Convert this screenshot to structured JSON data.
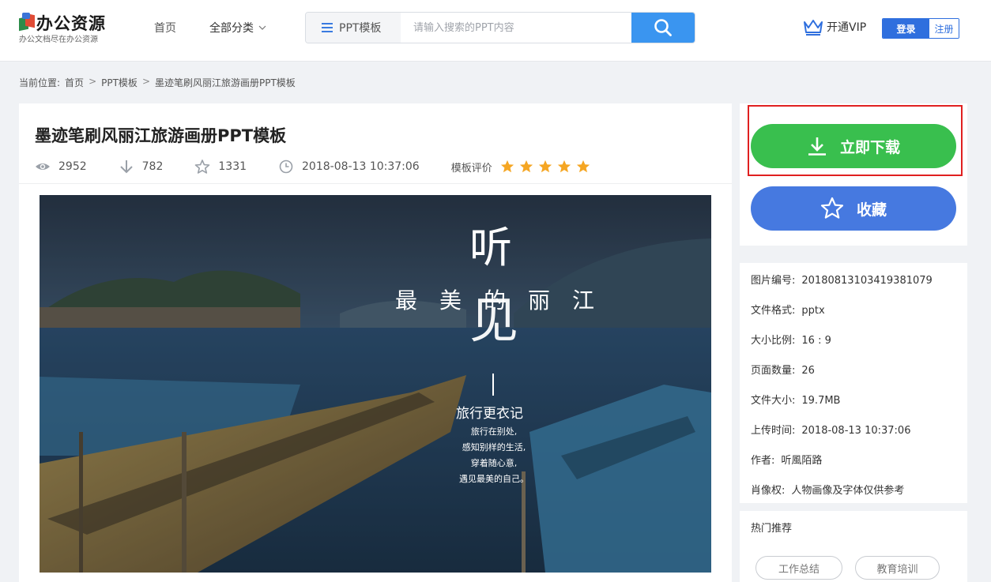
{
  "header": {
    "logo_title": "办公资源",
    "logo_subtitle": "办公文档尽在办公资源",
    "nav_home": "首页",
    "nav_categories": "全部分类",
    "search_type": "PPT模板",
    "search_placeholder": "请输入搜索的PPT内容",
    "vip_label": "开通VIP",
    "login_label": "登录",
    "register_label": "注册"
  },
  "breadcrumb": {
    "prefix": "当前位置:",
    "items": [
      "首页",
      "PPT模板",
      "墨迹笔刷风丽江旅游画册PPT模板"
    ],
    "separator": ">"
  },
  "detail": {
    "title": "墨迹笔刷风丽江旅游画册PPT模板",
    "views": "2952",
    "downloads": "782",
    "favorites": "1331",
    "upload_time": "2018-08-13 10:37:06",
    "rating_label": "模板评价",
    "rating_stars": 5
  },
  "preview": {
    "big_char_1": "听",
    "line_text": "最美的丽江",
    "big_char_2": "见",
    "subtitle": "旅行更衣记",
    "lines": [
      "旅行在别处,",
      "感知别样的生活,",
      "穿着随心意,",
      "遇见最美的自己。"
    ]
  },
  "sidebar": {
    "download_label": "立即下载",
    "favorite_label": "收藏",
    "info": [
      {
        "key": "图片编号:",
        "value": "20180813103419381079"
      },
      {
        "key": "文件格式:",
        "value": "pptx"
      },
      {
        "key": "大小比例:",
        "value": "16 : 9"
      },
      {
        "key": "页面数量:",
        "value": "26"
      },
      {
        "key": "文件大小:",
        "value": "19.7MB"
      },
      {
        "key": "上传时间:",
        "value": "2018-08-13 10:37:06"
      },
      {
        "key": "作者:",
        "value": "听風陌路"
      },
      {
        "key": "肖像权:",
        "value": "人物画像及字体仅供参考"
      }
    ],
    "hot_title": "热门推荐",
    "hot_tags": [
      "工作总结",
      "教育培训"
    ]
  },
  "colors": {
    "search_button": "#3a95f0",
    "download_button": "#39bf4e",
    "favorite_button": "#4679e0",
    "login_button": "#2f6fde",
    "star": "#f5a623",
    "highlight_border": "#e02020"
  }
}
